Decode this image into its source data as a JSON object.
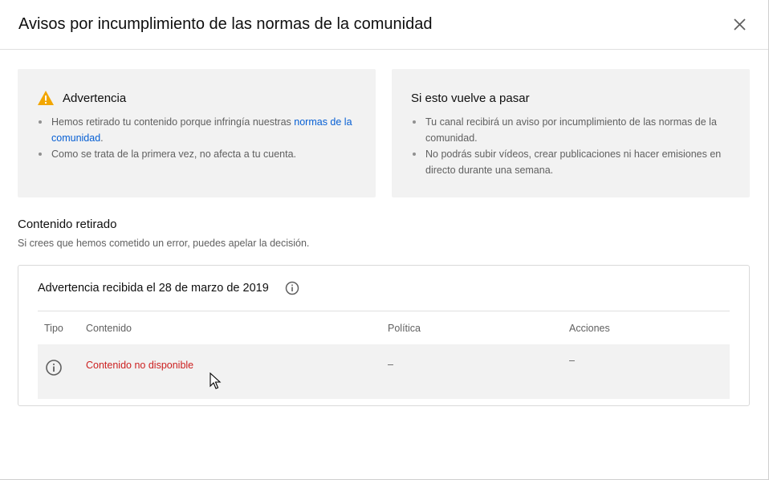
{
  "dialog": {
    "title": "Avisos por incumplimiento de las normas de la comunidad",
    "close_icon": "close-icon"
  },
  "warning_card": {
    "icon": "warning-icon",
    "icon_color": "#f2a600",
    "title": "Advertencia",
    "bullet1_text": "Hemos retirado tu contenido porque infringía nuestras ",
    "bullet1_link": "normas de la comunidad",
    "bullet1_end": ".",
    "bullet2": "Como se trata de la primera vez, no afecta a tu cuenta."
  },
  "repeat_card": {
    "title": "Si esto vuelve a pasar",
    "bullet1": "Tu canal recibirá un aviso por incumplimiento de las normas de la comunidad.",
    "bullet2": "No podrás subir vídeos, crear publicaciones ni hacer emisiones en directo durante una semana."
  },
  "removed": {
    "title": "Contenido retirado",
    "subtitle": "Si crees que hemos cometido un error, puedes apelar la decisión."
  },
  "strike": {
    "title": "Advertencia recibida el 28 de marzo de 2019",
    "info_icon": "info-icon",
    "columns": [
      "Tipo",
      "Contenido",
      "Política",
      "Acciones"
    ],
    "row": {
      "type_icon": "info-icon",
      "content": "Contenido no disponible",
      "content_color": "#cc1f1f",
      "policy": "–",
      "actions": "–"
    }
  },
  "colors": {
    "link": "#065fd4",
    "card_bg": "#f2f2f2"
  }
}
